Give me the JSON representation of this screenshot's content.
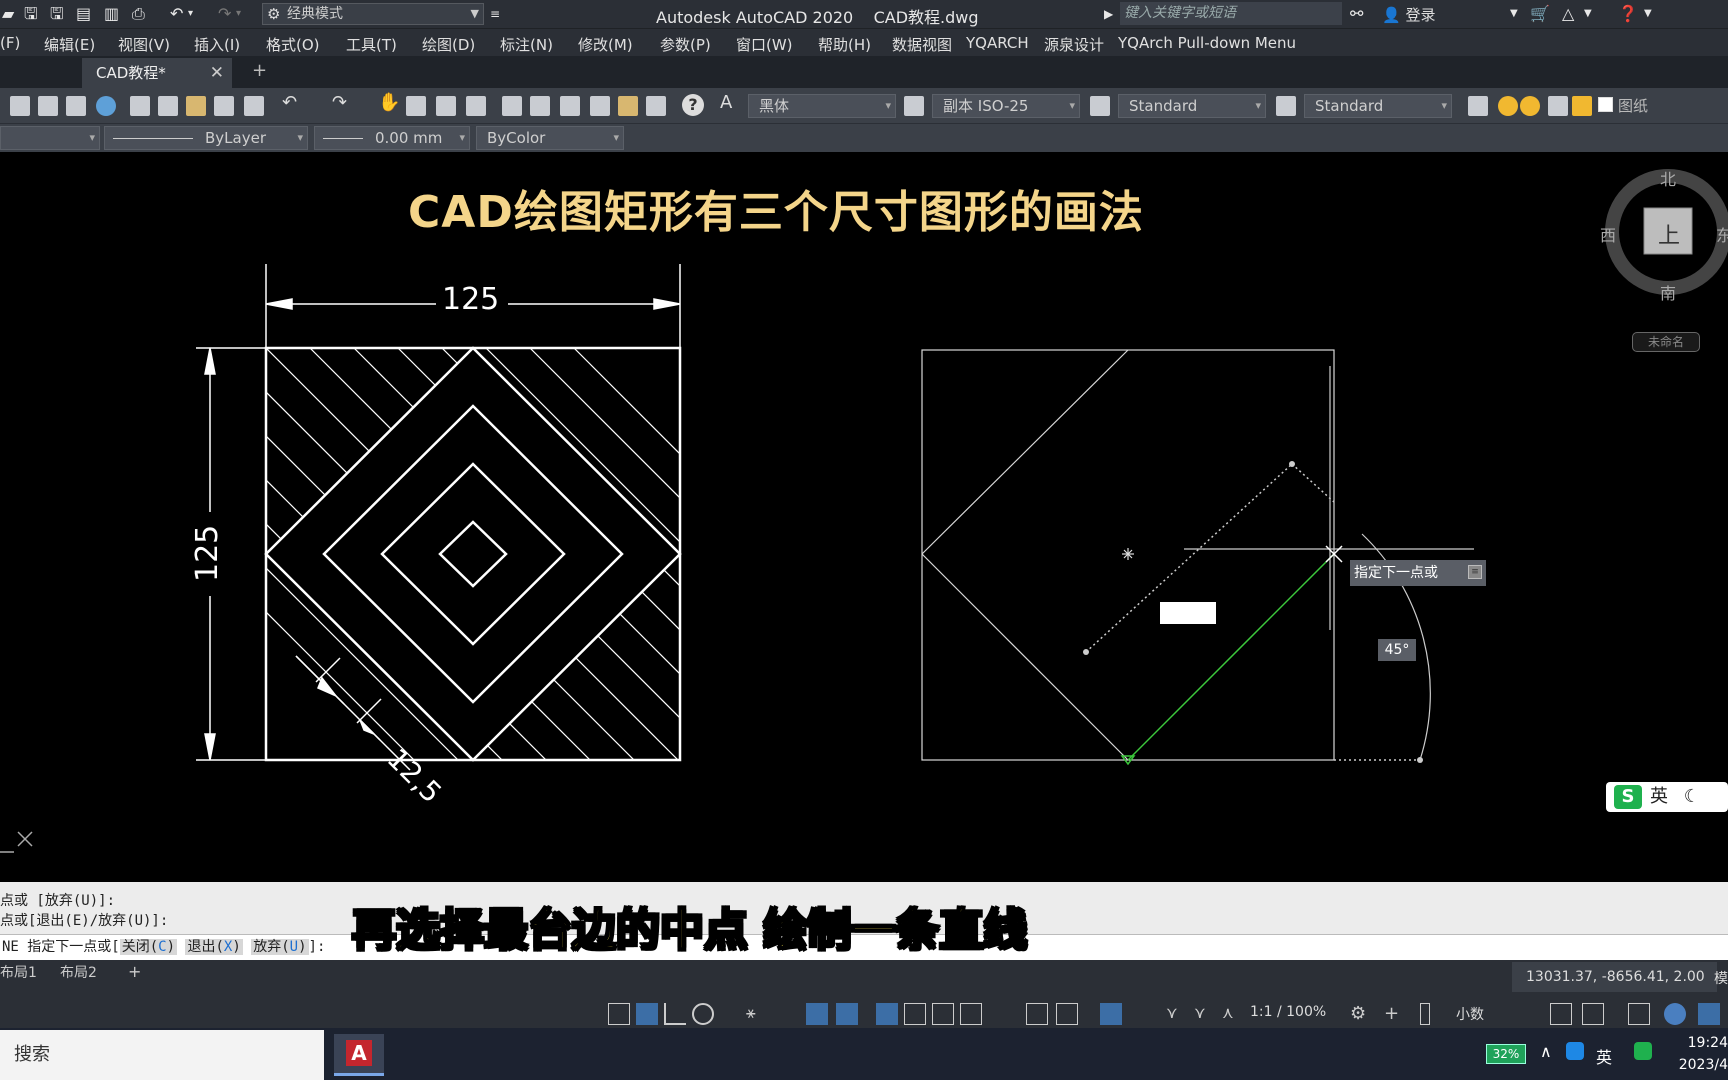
{
  "titlebar": {
    "workspace": "经典模式",
    "app_title": "Autodesk AutoCAD 2020    CAD教程.dwg",
    "search_placeholder": "键入关键字或短语",
    "login": "登录"
  },
  "menubar": {
    "items": [
      "(F)",
      "编辑(E)",
      "视图(V)",
      "插入(I)",
      "格式(O)",
      "工具(T)",
      "绘图(D)",
      "标注(N)",
      "修改(M)",
      "参数(P)",
      "窗口(W)",
      "帮助(H)",
      "数据视图",
      "YQARCH",
      "源泉设计",
      "YQArch Pull-down Menu"
    ]
  },
  "tabs": {
    "document": "CAD教程*",
    "close": "✕",
    "new": "+"
  },
  "toolbar": {
    "text_style_font": "黑体",
    "dim_style": "副本 ISO-25",
    "table_style": "Standard",
    "multileader_style": "Standard",
    "paper_label": "图纸",
    "linetype": "ByLayer",
    "lineweight": "0.00 mm",
    "plot_style": "ByColor"
  },
  "canvas": {
    "title": "CAD绘图矩形有三个尺寸图形的画法",
    "dim_top": "125",
    "dim_left": "125",
    "dim_offset": "12,5",
    "viewcube": {
      "north": "北",
      "south": "南",
      "west": "西",
      "east": "东",
      "face": "上"
    },
    "ucs_label": "未命名",
    "tooltip_prompt": "指定下一点或",
    "angle": "45°",
    "ime_label": "英"
  },
  "command": {
    "line1": "点或 [放弃(U)]:",
    "line2": "点或[退出(E)/放弃(U)]:",
    "prefix": "NE 指定下一点或[",
    "opt_close": "关闭",
    "opt_close_key": "C",
    "opt_exit": "退出",
    "opt_exit_key": "X",
    "opt_undo": "放弃",
    "opt_undo_key": "U",
    "suffix": "]:"
  },
  "subtitle": "再选择最台边的中点 绘制一条直线",
  "layout": {
    "tab1": "布局1",
    "tab2": "布局2",
    "add": "+",
    "coords": "13031.37, -8656.41, 2.00",
    "model": "模",
    "scale": "1:1 / 100%",
    "units": "小数"
  },
  "taskbar": {
    "search": "搜索",
    "battery": "32%",
    "lang": "英",
    "time": "19:24",
    "date": "2023/4"
  }
}
